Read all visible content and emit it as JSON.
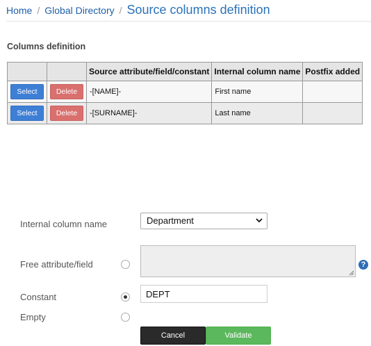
{
  "breadcrumb": {
    "home": "Home",
    "separator": "/",
    "directory": "Global Directory",
    "current": "Source columns definition"
  },
  "section_title": "Columns definition",
  "table": {
    "headers": [
      "",
      "",
      "Source attribute/field/constant",
      "Internal column name",
      "Postfix added"
    ],
    "rows": [
      {
        "select_label": "Select",
        "delete_label": "Delete",
        "source": "-[NAME]-",
        "internal_name": "First name",
        "postfix": ""
      },
      {
        "select_label": "Select",
        "delete_label": "Delete",
        "source": "-[SURNAME]-",
        "internal_name": "Last name",
        "postfix": ""
      }
    ]
  },
  "form": {
    "internal_column_label": "Internal column name",
    "internal_column_value": "Department",
    "free_attribute_label": "Free attribute/field",
    "free_attribute_value": "",
    "help_glyph": "?",
    "constant_label": "Constant",
    "constant_value": "DEPT",
    "empty_label": "Empty",
    "selected_option": "constant"
  },
  "buttons": {
    "cancel": "Cancel",
    "validate": "Validate"
  },
  "colors": {
    "link": "#1f5fa8",
    "select_button": "#3e7fd6",
    "delete_button": "#d9706d",
    "validate_button": "#5cb85c",
    "cancel_button": "#2a2a2a",
    "help_icon": "#2e6eb5"
  },
  "icons": {
    "dropdown": "chevron-down-icon",
    "help": "help-icon",
    "resize": "resize-grip-icon"
  }
}
